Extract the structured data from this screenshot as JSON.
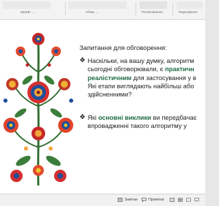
{
  "ribbon": {
    "groups": [
      "Шрифт",
      "Абзац",
      "Розпізнавання",
      "Редагування"
    ]
  },
  "slide": {
    "title": "Запитання для обговорення:",
    "bullet1": {
      "line1": "Наскільки, на вашу думку, алгоритм",
      "line2_pre": "сьогодні обговорювали, є ",
      "line2_bold": "практичн",
      "line3_bold": "реалістичним",
      "line3_post": " для застосування у в",
      "line4": "Які етапи виглядають найбільш або",
      "line5": "здійсненними?"
    },
    "bullet2": {
      "line1_pre": "Які ",
      "line1_bold": "основні виклики",
      "line1_post": " ви передбачає",
      "line2": "впровадженні такого алгоритму у"
    }
  },
  "statusbar": {
    "notes_label": "Замітки",
    "comments_label": "Примітки"
  }
}
